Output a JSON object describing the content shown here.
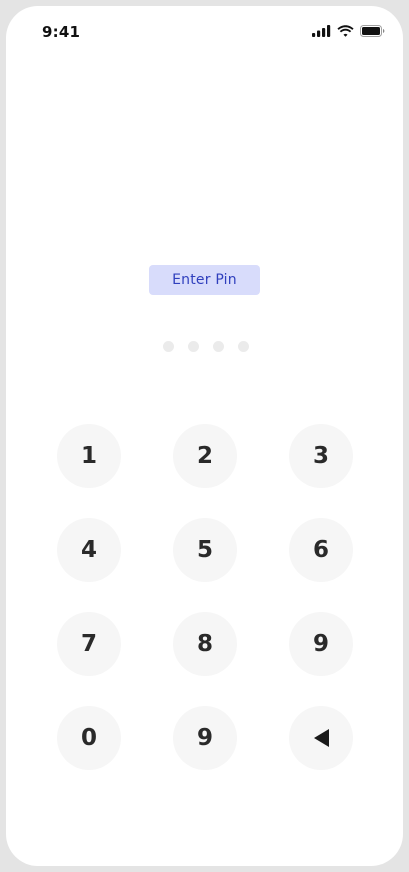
{
  "status_bar": {
    "time": "9:41",
    "icons": [
      "cellular-signal-icon",
      "wifi-icon",
      "battery-icon"
    ]
  },
  "prompt": {
    "label": "Enter Pin",
    "background": "#d8dcfb",
    "color": "#2f3fbd"
  },
  "pin": {
    "length": 4,
    "entered": 0
  },
  "keypad": {
    "keys": [
      {
        "label": "1"
      },
      {
        "label": "2"
      },
      {
        "label": "3"
      },
      {
        "label": "4"
      },
      {
        "label": "5"
      },
      {
        "label": "6"
      },
      {
        "label": "7"
      },
      {
        "label": "8"
      },
      {
        "label": "9"
      },
      {
        "label": "0"
      },
      {
        "label": "9"
      },
      {
        "icon": "backspace-triangle-icon"
      }
    ]
  }
}
